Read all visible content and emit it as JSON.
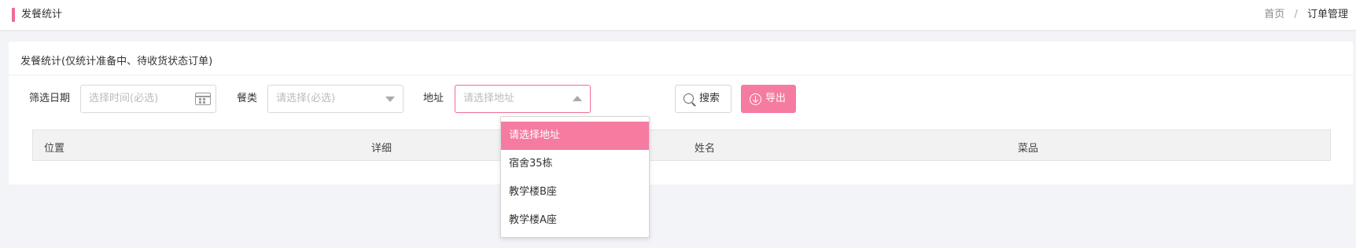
{
  "header": {
    "title": "发餐统计",
    "breadcrumb": {
      "home": "首页",
      "separator": "/",
      "current": "订单管理"
    },
    "accent_color": "#f06b94"
  },
  "card": {
    "title": "发餐统计(仅统计准备中、待收货状态订单)"
  },
  "filters": {
    "date": {
      "label": "筛选日期",
      "placeholder": "选择时间(必选)",
      "icon": "calendar-icon"
    },
    "meal": {
      "label": "餐类",
      "placeholder": "请选择(必选)"
    },
    "address": {
      "label": "地址",
      "placeholder": "请选择地址",
      "open": true
    }
  },
  "buttons": {
    "search": {
      "label": "搜索",
      "icon": "search-icon"
    },
    "export": {
      "label": "导出",
      "icon": "download-icon",
      "color": "#f57ba0"
    }
  },
  "table": {
    "columns": [
      "位置",
      "详细",
      "姓名",
      "菜品"
    ],
    "rows": []
  },
  "address_dropdown": {
    "options": [
      "请选择地址",
      "宿舍35栋",
      "教学楼B座",
      "教学楼A座"
    ],
    "selected_index": 0
  }
}
